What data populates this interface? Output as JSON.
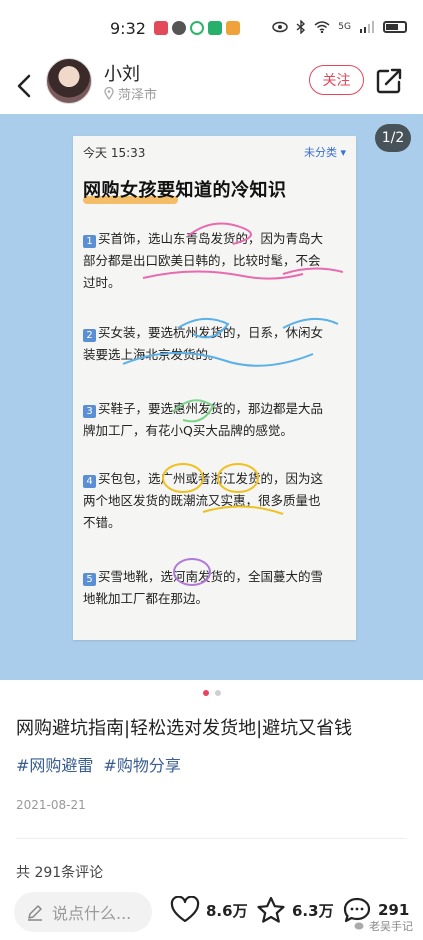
{
  "status_bar": {
    "time": "9:32",
    "network": "5G"
  },
  "header": {
    "username": "小刘",
    "location": "菏泽市",
    "follow_label": "关注"
  },
  "image": {
    "page_indicator": "1/2",
    "note": {
      "date": "今天 15:33",
      "category": "未分类",
      "title": "网购女孩要知道的冷知识",
      "items": [
        {
          "num": "1",
          "lines": [
            "买首饰，选山东青岛发货的，因为青岛大",
            "部分都是出口欧美日韩的，比较时髦，不会",
            "过时。"
          ]
        },
        {
          "num": "2",
          "lines": [
            "买女装，要选杭州发货的，日系，休闲女",
            "装要选上海北京发货的。"
          ]
        },
        {
          "num": "3",
          "lines": [
            "买鞋子，要选惠州发货的，那边都是大品",
            "牌加工厂，有花小Q买大品牌的感觉。"
          ]
        },
        {
          "num": "4",
          "lines": [
            "买包包，选广州或者浙江发货的，因为这",
            "两个地区发货的既潮流又实惠，很多质量也",
            "不错。"
          ]
        },
        {
          "num": "5",
          "lines": [
            "买雪地靴，选河南发货的，全国蔓大的雪",
            "地靴加工厂都在那边。"
          ]
        }
      ]
    }
  },
  "post": {
    "title": "网购避坑指南|轻松选对发货地|避坑又省钱",
    "tags": [
      "#网购避雷",
      "#购物分享"
    ],
    "date": "2021-08-21",
    "comments_count": "共 291条评论"
  },
  "bottom_bar": {
    "comment_placeholder": "说点什么...",
    "likes": "8.6万",
    "favorites": "6.3万",
    "comments": "291",
    "watermark": "老吴手记"
  },
  "colors": {
    "accent": "#e8455a",
    "image_bg": "#a9cdea",
    "tag": "#3a5d8f"
  }
}
